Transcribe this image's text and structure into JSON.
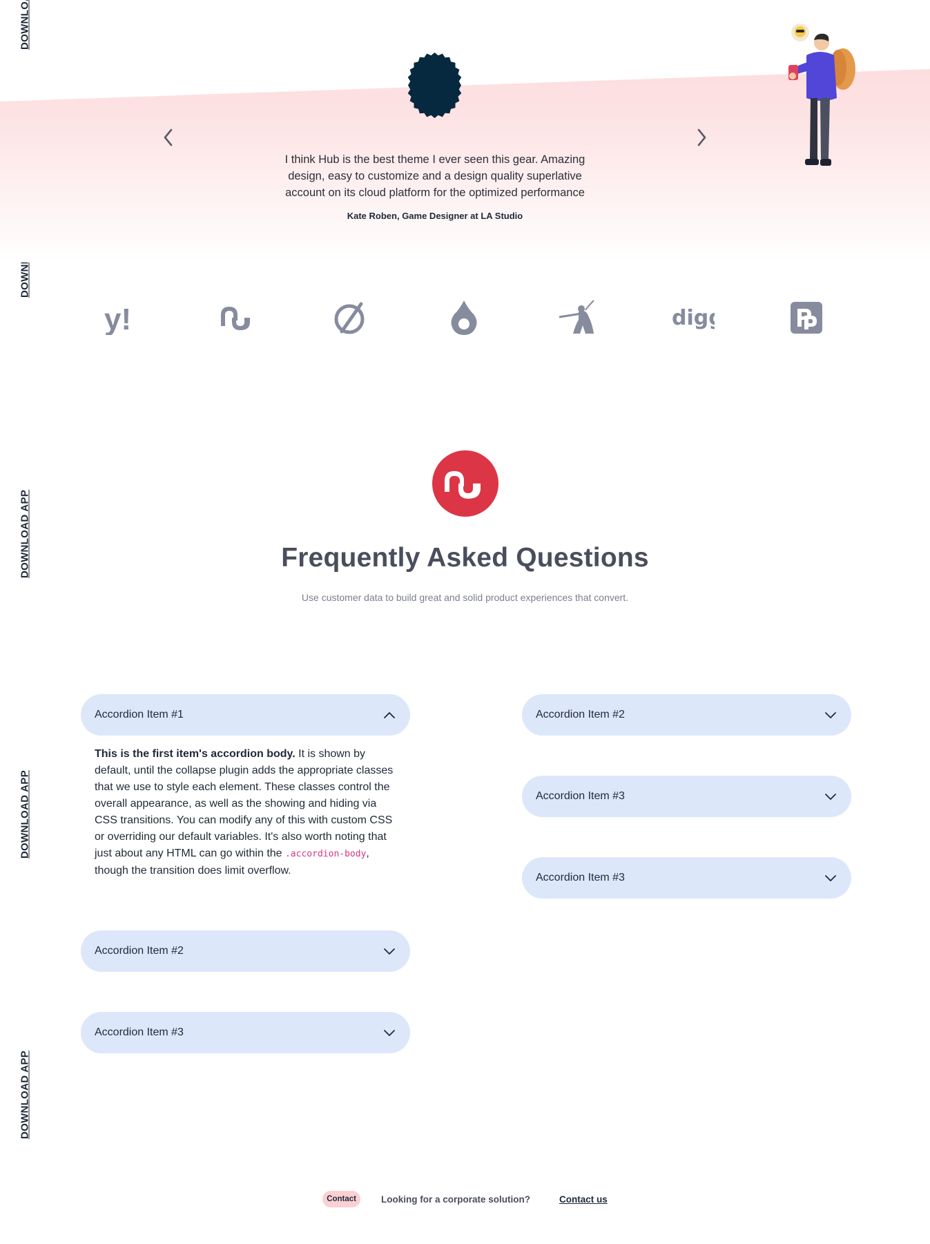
{
  "side_links": [
    {
      "label": "DOWNLOAD APP"
    },
    {
      "label": "DOWNLOAD APP"
    },
    {
      "label": "DOWNLOAD APP"
    },
    {
      "label": "DOWNLOAD APP"
    },
    {
      "label": "DOWNLOAD APP"
    }
  ],
  "testimonial": {
    "quote": "I think Hub is the best theme I ever seen this gear. Amazing design, easy to customize and a design quality superlative account on its cloud platform for the optimized performance",
    "author": "Kate Roben, Game Designer at LA Studio",
    "prev_icon": "chevron-left-icon",
    "next_icon": "chevron-right-icon"
  },
  "logos": [
    {
      "name": "yahoo-logo",
      "text": "y!"
    },
    {
      "name": "stumbleupon-logo",
      "text": ""
    },
    {
      "name": "open-source-logo",
      "text": ""
    },
    {
      "name": "drupal-logo",
      "text": ""
    },
    {
      "name": "gnu-logo",
      "text": ""
    },
    {
      "name": "digg-logo",
      "text": "digg"
    },
    {
      "name": "producthunt-logo",
      "text": ""
    }
  ],
  "faq": {
    "title": "Frequently Asked Questions",
    "subtitle": "Use customer data to build great and solid product experiences that convert.",
    "emblem": "stumbleupon-emblem",
    "accent_color": "#dc3545",
    "accordion_bg": "#dde7fa",
    "left_column": [
      {
        "label": "Accordion Item #1",
        "expanded": true
      },
      {
        "label": "Accordion Item #2",
        "expanded": false
      },
      {
        "label": "Accordion Item #3",
        "expanded": false
      }
    ],
    "right_column": [
      {
        "label": "Accordion Item #2",
        "expanded": false
      },
      {
        "label": "Accordion Item #3",
        "expanded": false
      },
      {
        "label": "Accordion Item #3",
        "expanded": false
      }
    ],
    "body": {
      "strong": "This is the first item's accordion body.",
      "text1": " It is shown by default, until the collapse plugin adds the appropriate classes that we use to style each element. These classes control the overall appearance, as well as the showing and hiding via CSS transitions. You can modify any of this with custom CSS or overriding our default variables. It's also worth noting that just about any HTML can go within the ",
      "code": ".accordion-body",
      "text2": ", though the transition does limit overflow."
    }
  },
  "footer": {
    "pill": "Contact",
    "text": "Looking for a corporate solution?",
    "link": "Contact us"
  }
}
